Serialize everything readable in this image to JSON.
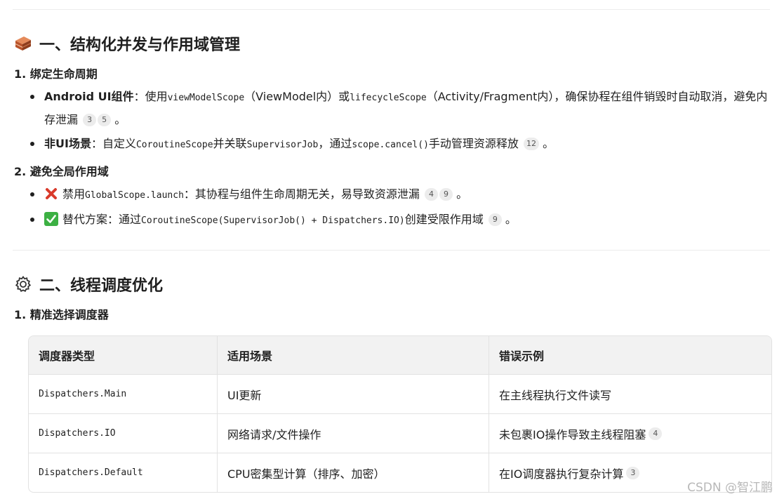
{
  "section1": {
    "title": "一、结构化并发与作用域管理",
    "sub1": {
      "title": "1. 绑定生命周期",
      "items": [
        {
          "bold": "Android UI组件",
          "t1": "：使用",
          "code1": "viewModelScope",
          "t2": "（ViewModel内）或",
          "code2": "lifecycleScope",
          "t3": "（Activity/Fragment内），确保协程在组件销毁时自动取消，避免内存泄漏",
          "cites": [
            "3",
            "5"
          ],
          "end": "。"
        },
        {
          "bold": "非UI场景",
          "t1": "：自定义",
          "code1": "CoroutineScope",
          "t2": "并关联",
          "code2": "SupervisorJob",
          "t3": "，通过",
          "code3": "scope.cancel()",
          "t4": "手动管理资源释放",
          "cites": [
            "12"
          ],
          "end": "。"
        }
      ]
    },
    "sub2": {
      "title": "2. 避免全局作用域",
      "items": [
        {
          "icon": "cross-mark-icon",
          "t1": "禁用",
          "code1": "GlobalScope.launch",
          "t2": "：其协程与组件生命周期无关，易导致资源泄漏",
          "cites": [
            "4",
            "9"
          ],
          "end": "。"
        },
        {
          "icon": "check-mark-icon",
          "t1": "替代方案：通过",
          "code1": "CoroutineScope(SupervisorJob() + Dispatchers.IO)",
          "t2": "创建受限作用域",
          "cites": [
            "9"
          ],
          "end": "。"
        }
      ]
    }
  },
  "section2": {
    "title": "二、线程调度优化",
    "sub1": {
      "title": "1. 精准选择调度器"
    },
    "table": {
      "headers": [
        "调度器类型",
        "适用场景",
        "错误示例"
      ],
      "rows": [
        {
          "dispatcher": "Dispatchers.Main",
          "scene": "UI更新",
          "example": "在主线程执行文件读写",
          "cite": ""
        },
        {
          "dispatcher": "Dispatchers.IO",
          "scene": "网络请求/文件操作",
          "example": "未包裹IO操作导致主线程阻塞",
          "cite": "4"
        },
        {
          "dispatcher": "Dispatchers.Default",
          "scene": "CPU密集型计算（排序、加密）",
          "example": "在IO调度器执行复杂计算",
          "cite": "3"
        }
      ]
    }
  },
  "watermark": "CSDN @智江鹏",
  "colors": {
    "cross": "#d93a2b",
    "check": "#3cb043",
    "citeBg": "#ececec",
    "brick": "#c8643c"
  }
}
